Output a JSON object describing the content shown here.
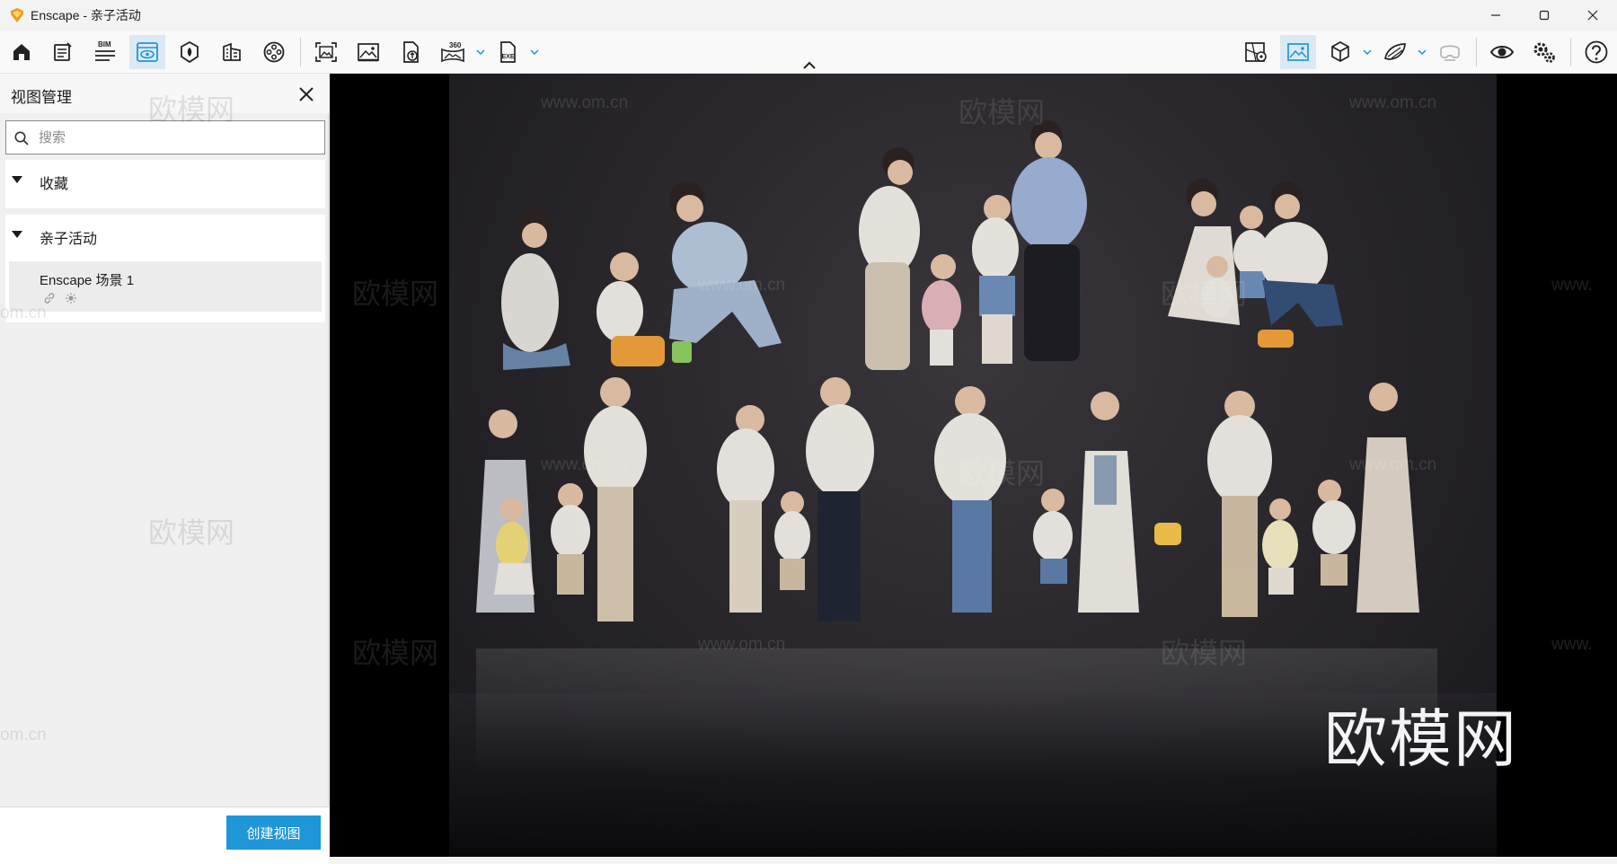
{
  "window": {
    "title": "Enscape - 亲子活动"
  },
  "toolbar": {
    "bim_label": "BIM",
    "pano_label": "360",
    "exe_label": "EXE"
  },
  "sidebar": {
    "title": "视图管理",
    "search_placeholder": "搜索",
    "groups": [
      {
        "label": "收藏"
      },
      {
        "label": "亲子活动",
        "items": [
          {
            "name": "Enscape 场景 1"
          }
        ]
      }
    ],
    "create_button": "创建视图"
  },
  "viewport": {
    "watermark_text": "欧模网",
    "watermark_url": "www.om.cn",
    "watermark_url_partial": "om.cn",
    "watermark_url_cut": "www.",
    "brand_mark": "欧模网"
  },
  "colors": {
    "accent": "#1e96d8",
    "active_tool": "#dbe9f4"
  }
}
